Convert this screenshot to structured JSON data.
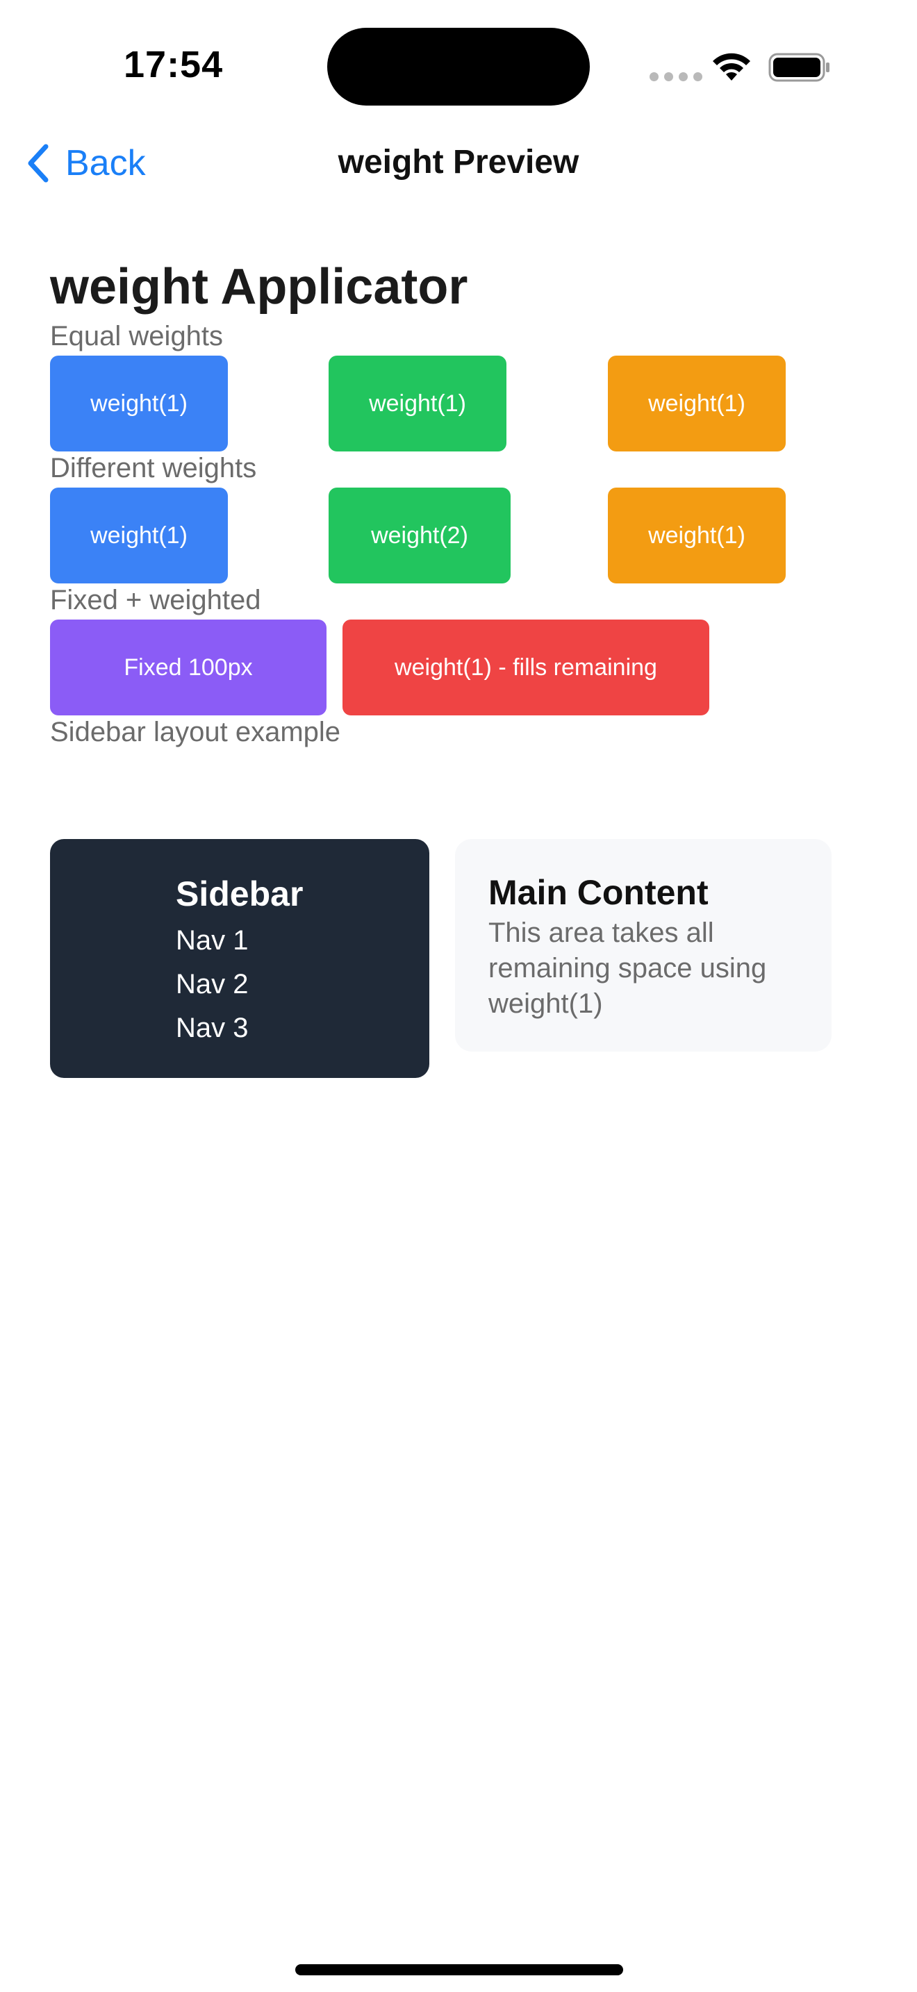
{
  "status_bar": {
    "time": "17:54"
  },
  "nav": {
    "back_label": "Back",
    "title": "weight Preview",
    "accent_color": "#1a7ff7"
  },
  "page": {
    "heading": "weight Applicator"
  },
  "sections": {
    "equal": {
      "label": "Equal weights",
      "boxes": [
        "weight(1)",
        "weight(1)",
        "weight(1)"
      ]
    },
    "different": {
      "label": "Different weights",
      "boxes": [
        "weight(1)",
        "weight(2)",
        "weight(1)"
      ]
    },
    "fixed": {
      "label": "Fixed + weighted",
      "boxes": [
        "Fixed 100px",
        "weight(1) - fills remaining"
      ]
    },
    "sidebar_layout": {
      "label": "Sidebar layout example",
      "sidebar_title": "Sidebar",
      "nav_items": [
        "Nav 1",
        "Nav 2",
        "Nav 3"
      ],
      "main_title": "Main Content",
      "main_description": "This area takes all remaining space using weight(1)"
    }
  },
  "colors": {
    "blue": "#3b82f6",
    "green": "#22c55e",
    "orange": "#f39c12",
    "purple": "#8b5cf6",
    "red": "#ef4444",
    "sidebar_bg": "#1f2937",
    "main_bg": "#f7f8fa"
  },
  "icons": {
    "back": "chevron-left-icon",
    "wifi": "wifi-icon",
    "battery": "battery-icon",
    "signal": "cellular-signal-icon"
  }
}
